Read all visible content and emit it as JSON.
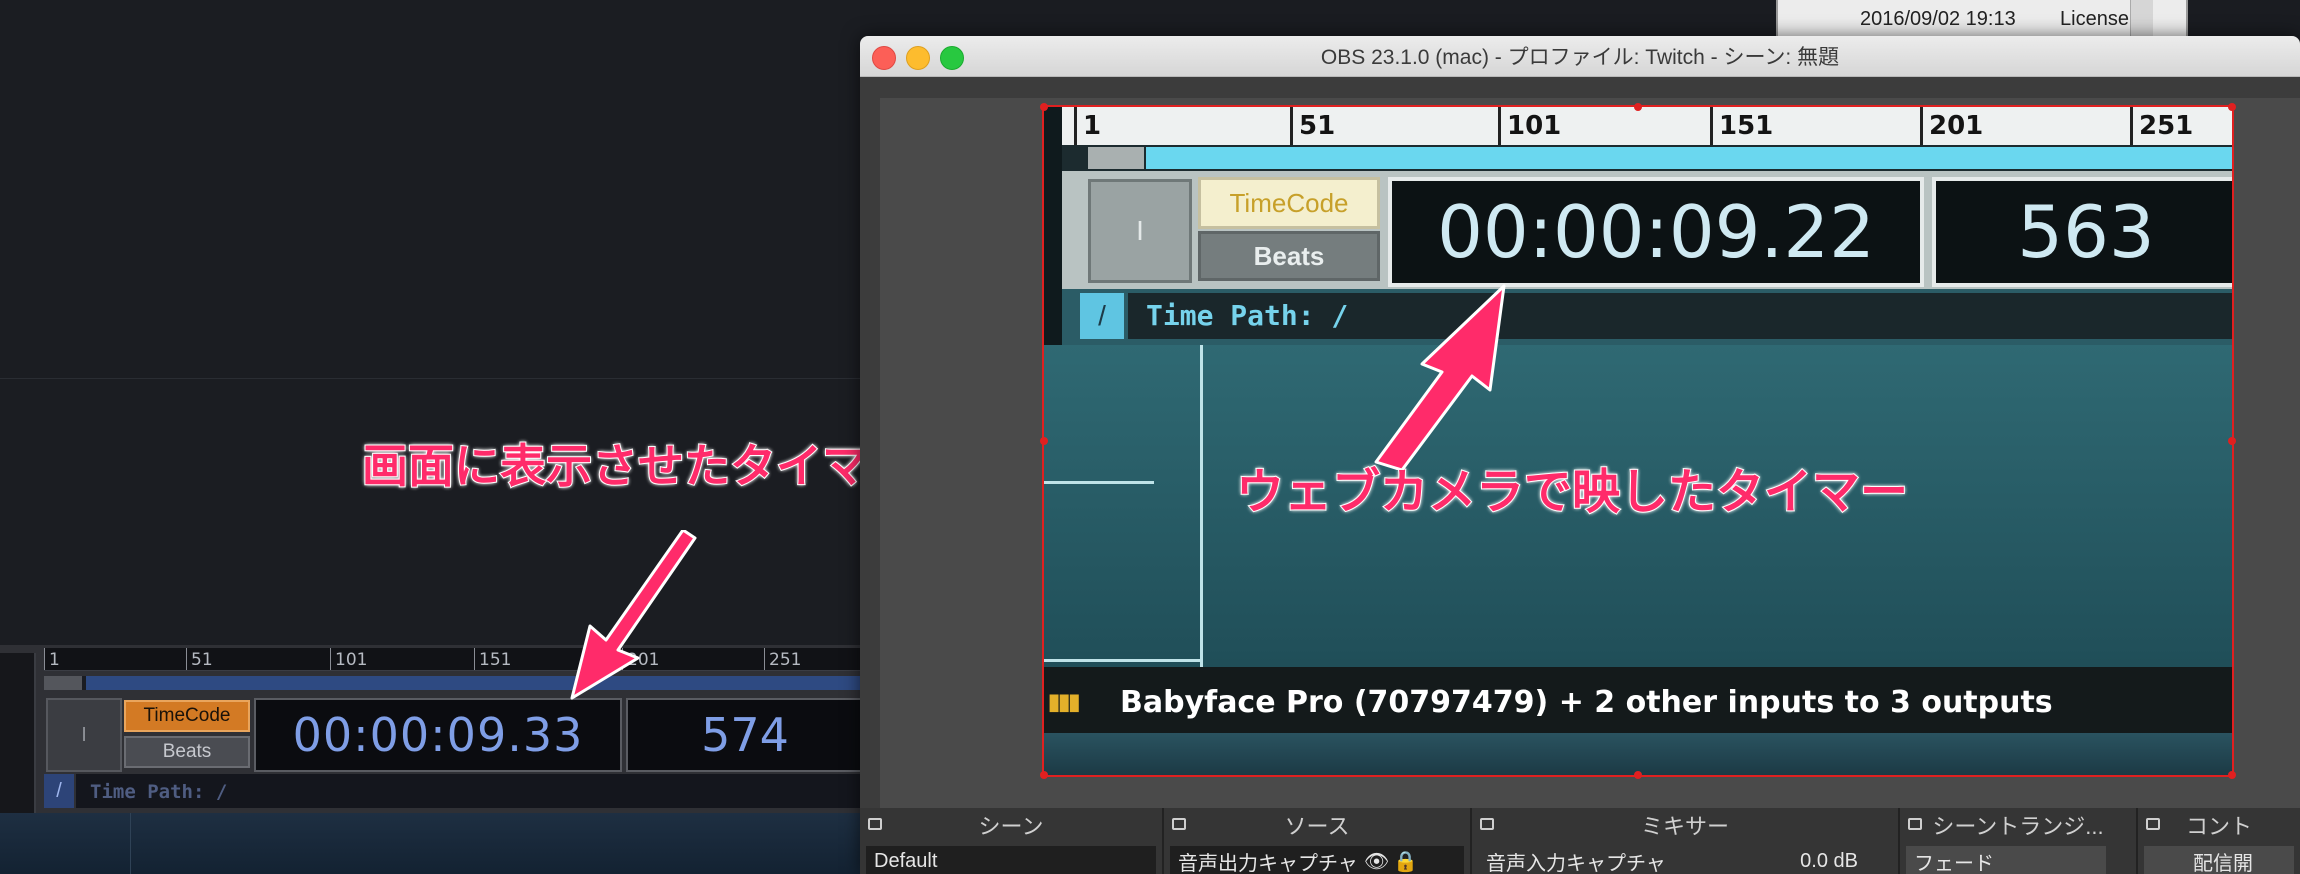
{
  "left_app": {
    "ruler_ticks": [
      "1",
      "51",
      "101",
      "151",
      "201",
      "251"
    ],
    "i_label": "I",
    "timecode_label": "TimeCode",
    "beats_label": "Beats",
    "timecode_value": "00:00:09.33",
    "beats_value": "574",
    "path_slash": "/",
    "path_label": "Time Path: /"
  },
  "annotations": {
    "left": "画面に表示させたタイマー",
    "right": "ウェブカメラで映したタイマー"
  },
  "obs": {
    "title": "OBS 23.1.0 (mac) - プロファイル: Twitch - シーン: 無題",
    "webcam": {
      "ruler_ticks": [
        "1",
        "51",
        "101",
        "151",
        "201",
        "251"
      ],
      "i_label": "I",
      "timecode_label": "TimeCode",
      "beats_label": "Beats",
      "timecode_value": "00:00:09.22",
      "beats_value": "563",
      "path_slash": "/",
      "path_label": "Time Path: /",
      "status_text": "Babyface Pro (70797479) + 2 other inputs to 3 outputs"
    },
    "dock": {
      "scenes": {
        "title": "シーン",
        "item": "Default"
      },
      "sources": {
        "title": "ソース",
        "item": "音声出力キャプチャ"
      },
      "mixer": {
        "title": "ミキサー",
        "item": "音声入力キャプチャ",
        "level": "0.0 dB"
      },
      "transitions": {
        "title": "シーントランジ...",
        "item": "フェード"
      },
      "controls": {
        "title": "コント",
        "item": "配信開"
      }
    }
  },
  "mac_menubar": {
    "datetime": "2016/09/02 19:13",
    "license": "License"
  },
  "colors": {
    "accent_orange": "#d37a24",
    "timer_blue": "#7f9ee6",
    "annotation_pink": "#ff2b6a",
    "selection_red": "#e02020"
  }
}
